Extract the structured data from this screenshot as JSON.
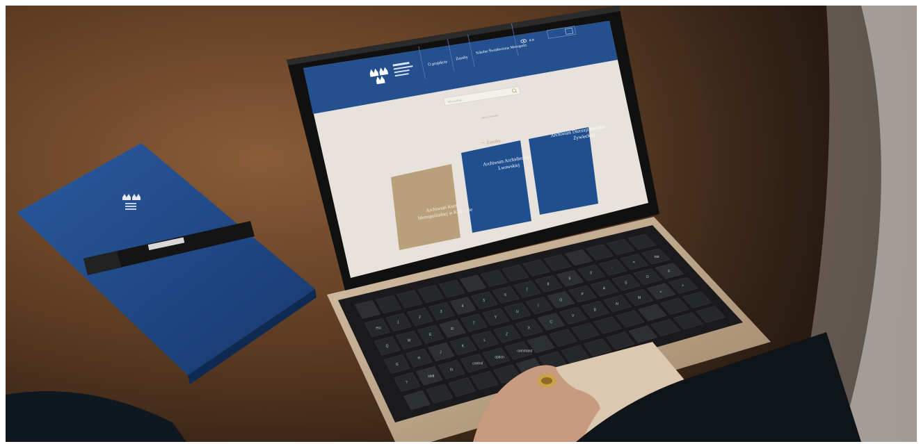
{
  "site": {
    "nav": [
      "O projekcie",
      "Zasoby",
      "Szkolne Światłocienie Metropolii"
    ],
    "search_placeholder": "Wyszukaj...",
    "section_heading": "Zasoby",
    "small_caption": "zobacz wszystkie",
    "tiles": [
      {
        "label": "Archiwum Kurii Metropolitalnej w Krakowie",
        "color": "#b9a07a"
      },
      {
        "label": "Archiwum Archidiecezji Lwowskiej",
        "color": "#1f4f8f"
      },
      {
        "label": "Archiwum Diecezji Bielsko-Żywieckiej",
        "color": "#1f4f8f"
      }
    ]
  },
  "colors": {
    "brand_blue": "#24508f",
    "notebook_blue": "#1e4a8a",
    "screen_bg": "#e7e3dc",
    "gold_tile": "#b9a07a",
    "laptop_gold": "#c9b39a"
  },
  "keyboard": {
    "key_labels": [
      "esc",
      "1",
      "2",
      "3",
      "4",
      "5",
      "6",
      "7",
      "8",
      "9",
      "0",
      "-",
      "=",
      "tab",
      "Q",
      "W",
      "E",
      "R",
      "T",
      "Y",
      "U",
      "I",
      "O",
      "P",
      "A",
      "S",
      "D",
      "F",
      "G",
      "H",
      "J",
      "K",
      "L",
      "Z",
      "X",
      "C",
      "V",
      "B",
      "N",
      "M",
      "<",
      ">",
      "?",
      "shift",
      "fn",
      "control",
      "option",
      "command"
    ]
  }
}
